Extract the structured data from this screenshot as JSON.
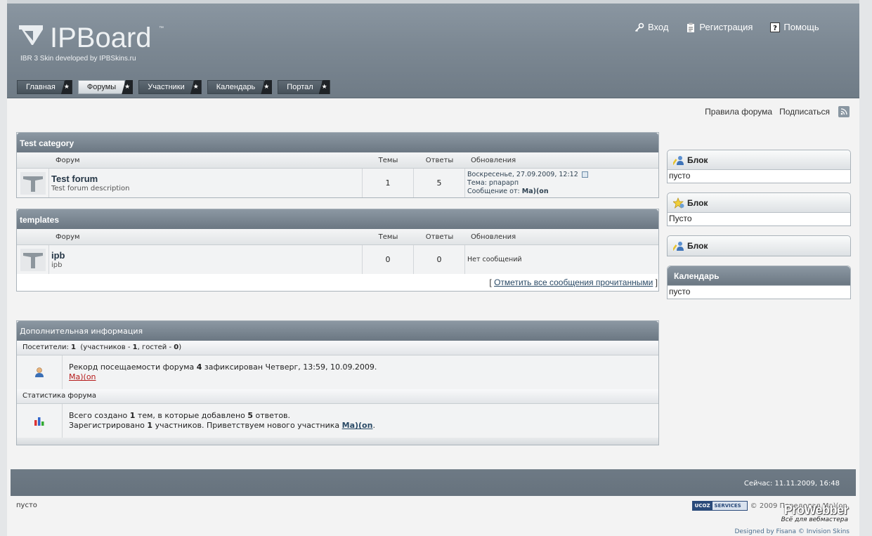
{
  "header": {
    "logo_text": "IPBoard",
    "logo_tm": "™",
    "logo_sub": "IBR 3 Skin developed by IPBSkins.ru",
    "links": [
      {
        "label": "Вход",
        "icon": "key-icon"
      },
      {
        "label": "Регистрация",
        "icon": "clipboard-icon"
      },
      {
        "label": "Помощь",
        "icon": "help-icon"
      }
    ],
    "tabs": [
      {
        "label": "Главная",
        "active": false
      },
      {
        "label": "Форумы",
        "active": true
      },
      {
        "label": "Участники",
        "active": false
      },
      {
        "label": "Календарь",
        "active": false
      },
      {
        "label": "Портал",
        "active": false
      }
    ],
    "tab_star": "★"
  },
  "subbar": {
    "rules": "Правила форума",
    "subscribe": "Подписаться"
  },
  "categories": [
    {
      "title": "Test category",
      "cols": {
        "forum": "Форум",
        "topics": "Темы",
        "replies": "Ответы",
        "updates": "Обновления"
      },
      "forum": {
        "name": "Test forum",
        "desc": "Test forum description",
        "topics": "1",
        "replies": "5",
        "last_date": "Воскресенье, 27.09.2009, 12:12",
        "last_topic_label": "Тема:",
        "last_topic": "рпарарп",
        "last_author_label": "Сообщение от:",
        "last_author": "Ma)(on"
      }
    },
    {
      "title": "templates",
      "cols": {
        "forum": "Форум",
        "topics": "Темы",
        "replies": "Ответы",
        "updates": "Обновления"
      },
      "forum": {
        "name": "ipb",
        "desc": "ipb",
        "topics": "0",
        "replies": "0",
        "no_posts": "Нет сообщений"
      }
    }
  ],
  "mark_all": {
    "open": "[",
    "label": "Отметить все сообщения прочитанными",
    "close": "]"
  },
  "info": {
    "title": "Дополнительная информация",
    "visitors_label": "Посетители:",
    "visitors_count": "1",
    "visitors_members_label": "(участников -",
    "visitors_members": "1",
    "visitors_guests_label": ", гостей -",
    "visitors_guests": "0",
    "visitors_close": ")",
    "record_text_1": "Рекорд посещаемости форума",
    "record_count": "4",
    "record_text_2": "зафиксирован Четверг, 13:59, 10.09.2009.",
    "record_user": "Ma)(on",
    "stats_title": "Статистика форума",
    "stats_1a": "Всего создано",
    "stats_topics": "1",
    "stats_1b": "тем, в которые добавлено",
    "stats_replies": "5",
    "stats_1c": "ответов.",
    "stats_2a": "Зарегистрировано",
    "stats_members": "1",
    "stats_2b": "участников. Приветствуем нового участника",
    "stats_newest": "Ma)(on",
    "stats_2c": "."
  },
  "sidebar": [
    {
      "title": "Блок",
      "body": "пусто",
      "icon": "user-edit-icon"
    },
    {
      "title": "Блок",
      "body": "Пусто",
      "icon": "star-icon"
    },
    {
      "title": "Блок",
      "body": "",
      "icon": "user-edit-icon"
    },
    {
      "title": "Календарь",
      "body": "пусто",
      "icon": ""
    }
  ],
  "footer": {
    "now": "Сейчас: 11.11.2009, 16:48",
    "left": "пусто",
    "copyright": "© 2009  Переделал Ma)(on.",
    "ucoz_1": "UCOZ",
    "ucoz_2": "SERVICES",
    "prowebber_1": "ProWebber",
    "prowebber_2": "Всё для вебмастера",
    "designed": "Designed by Fisana © Invision Skins"
  }
}
